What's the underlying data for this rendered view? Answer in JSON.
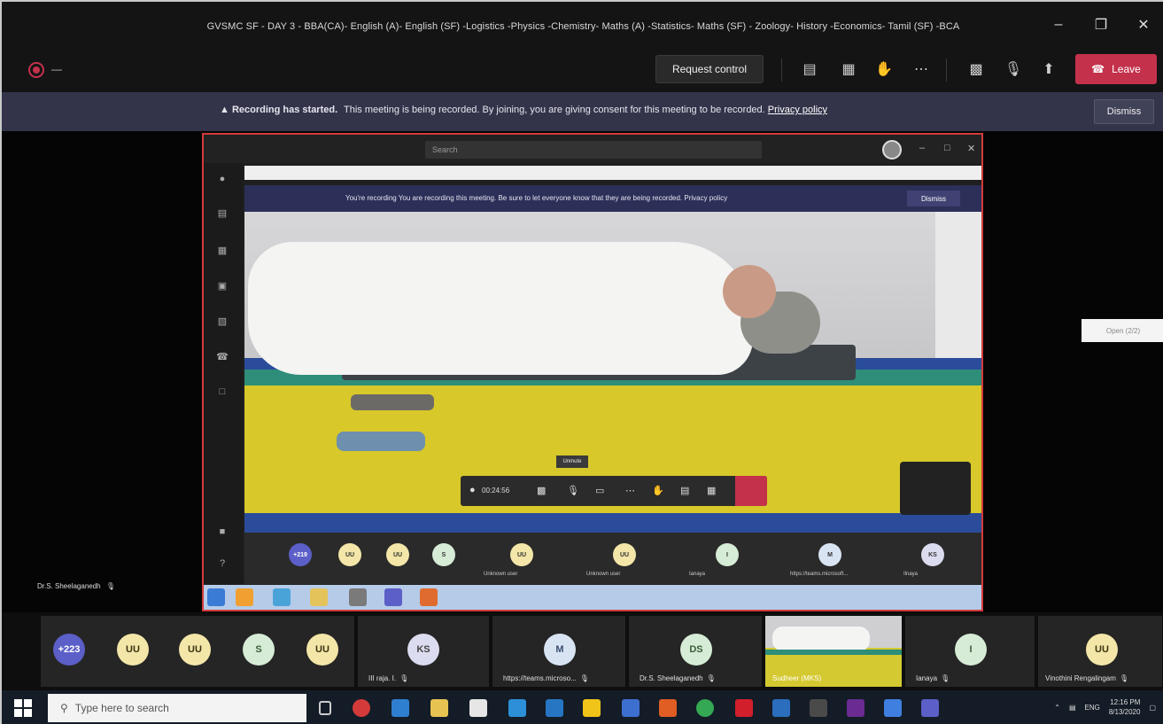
{
  "window": {
    "title": "GVSMC SF - DAY 3 - BBA(CA)- English (A)- English (SF) -Logistics -Physics -Chemistry- Maths (A) -Statistics- Maths (SF) - Zoology- History -Economics- Tamil (SF) -BCA"
  },
  "toolbar": {
    "timer": "—",
    "request_control": "Request control",
    "leave": "Leave"
  },
  "banner": {
    "bold": "Recording has started.",
    "text": "This meeting is being recorded. By joining, you are giving consent for this meeting to be recorded.",
    "link": "Privacy policy",
    "dismiss": "Dismiss"
  },
  "shared_screen": {
    "search_placeholder": "Search",
    "recbar_text": "You're recording  You are recording this meeting. Be sure to let everyone know that they are being recorded. Privacy policy",
    "recbar_dismiss": "Dismiss",
    "tooltip": "Unmute",
    "timer": "00:24:56",
    "strip_avatars": [
      "+219",
      "UU",
      "UU",
      "S"
    ],
    "strip_tiles": [
      {
        "initials": "UU",
        "label": "Unknown user"
      },
      {
        "initials": "UU",
        "label": "Unknown user"
      },
      {
        "initials": "I",
        "label": "Ianaya"
      },
      {
        "initials": "M",
        "label": "https://teams.microsoft..."
      },
      {
        "initials": "KS",
        "label": "Ilnaya"
      }
    ]
  },
  "side_label": "Open (2/2)",
  "presenter": "Dr.S. Sheelaganedh",
  "participants": {
    "overflow": "+223",
    "avatars": [
      "UU",
      "UU",
      "S",
      "UU"
    ],
    "tiles": [
      {
        "initials": "KS",
        "label": "III raja. I.",
        "color": "#dcdcf0"
      },
      {
        "initials": "M",
        "label": "https://teams.microso...",
        "color": "#d9e4f3"
      },
      {
        "initials": "DS",
        "label": "Dr.S. Sheelaganedh",
        "color": "#d6ecd6"
      },
      {
        "initials": "",
        "label": "Sudheer (MKS)",
        "color": ""
      },
      {
        "initials": "I",
        "label": "Ianaya",
        "color": "#d6ecd6"
      },
      {
        "initials": "UU",
        "label": "Vinothini Rengalingam",
        "color": "#f3e6a8"
      }
    ]
  },
  "taskbar": {
    "search_placeholder": "Type here to search",
    "lang": "ENG",
    "time": "12:16 PM",
    "date": "8/13/2020"
  },
  "colors": {
    "leave": "#c4314b",
    "banner": "#33344a",
    "share_border": "#d33b3b",
    "avatar_overflow": "#5b5fc7",
    "avatar_uu": "#f3e6a8"
  }
}
